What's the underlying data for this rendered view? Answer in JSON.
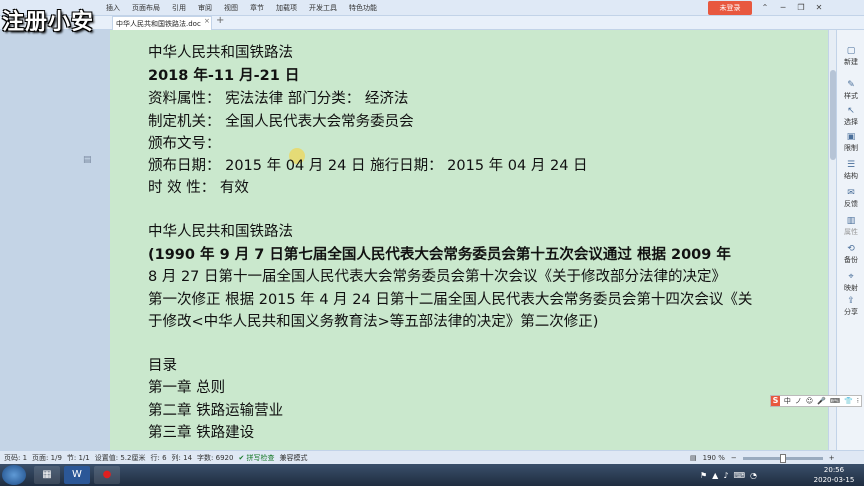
{
  "watermark": "注册小安",
  "app": {
    "menu_tabs": [
      "插入",
      "页面布局",
      "引用",
      "审阅",
      "视图",
      "章节",
      "加载项",
      "开发工具",
      "特色功能"
    ],
    "login_button": "未登录",
    "window_controls": [
      "⌃",
      "─",
      "❐",
      "✕"
    ]
  },
  "document_tab": {
    "title": "中华人民共和国铁路法.doc",
    "close": "×",
    "new_tab": "+"
  },
  "document": {
    "lines": [
      "中华人民共和国铁路法",
      "2018 年-11 月-21 日",
      "资料属性：    宪法法律        部门分类：    经济法",
      "制定机关：    全国人民代表大会常务委员会",
      "颁布文号：",
      "颁布日期：    2015 年 04 月 24 日        施行日期：    2015 年 04 月 24 日",
      "时  效  性：    有效",
      "",
      "中华人民共和国铁路法",
      "    (1990 年 9 月 7 日第七届全国人民代表大会常务委员会第十五次会议通过   根据 2009 年",
      "8 月 27 日第十一届全国人民代表大会常务委员会第十次会议《关于修改部分法律的决定》",
      "第一次修正  根据 2015 年 4 月 24 日第十二届全国人民代表大会常务委员会第十四次会议《关",
      "于修改<中华人民共和国义务教育法>等五部法律的决定》第二次修正)",
      "",
      "目录",
      "    第一章    总则",
      "    第二章    铁路运输营业",
      "    第三章    铁路建设"
    ]
  },
  "side_panel": {
    "items": [
      "新建",
      "样式",
      "选择",
      "限制",
      "结构",
      "反馈",
      "属性",
      "备份",
      "映射",
      "分享"
    ]
  },
  "ime": {
    "logo": "S",
    "labels": [
      "中",
      "ノ",
      "☺",
      "🎤",
      "⌨",
      "👕",
      "⁝"
    ]
  },
  "status": {
    "page_num": "页码: 1",
    "pages": "页面: 1/9",
    "section": "节: 1/1",
    "setting": "设置值: 5.2厘米",
    "row": "行: 6",
    "col": "列: 14",
    "words": "字数: 6920",
    "spell": "拼写检查",
    "compat": "兼容模式",
    "zoom": "190 %",
    "zoom_level": 0.5
  },
  "taskbar": {
    "apps": [
      "▦",
      "W",
      "●"
    ],
    "tray_icons": [
      "⚑",
      "▲",
      "♪",
      "⌨",
      "◔"
    ],
    "time": "20:56",
    "date": "2020-03-15"
  }
}
